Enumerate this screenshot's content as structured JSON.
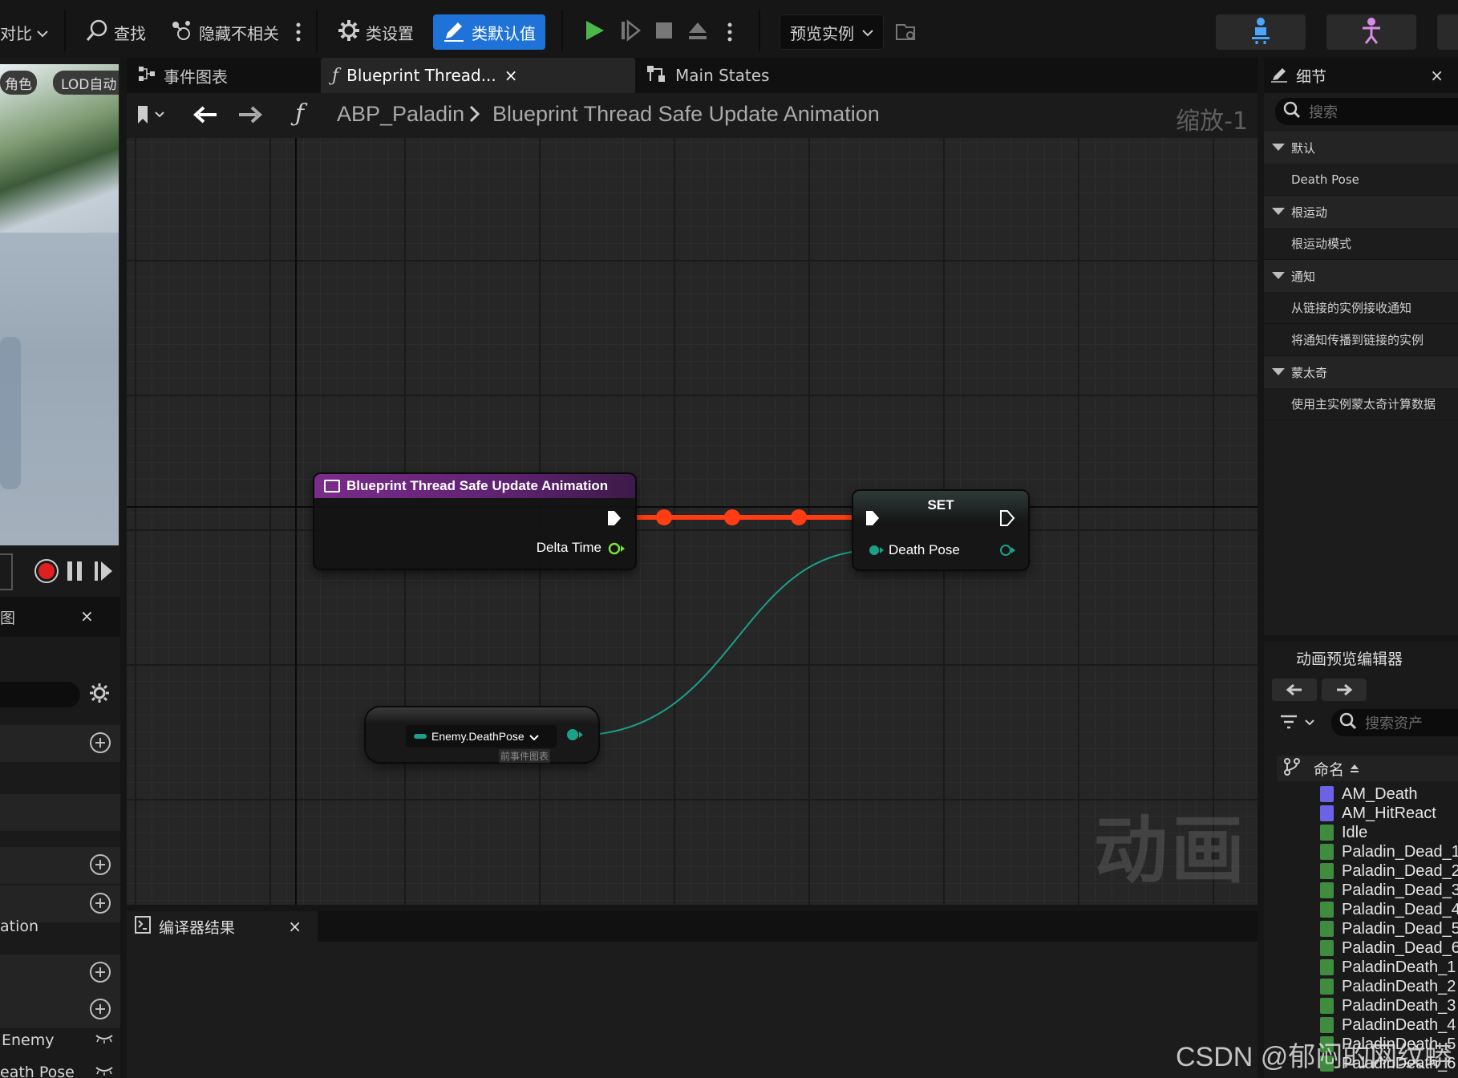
{
  "toolbar": {
    "compare_label": "对比",
    "find_label": "查找",
    "hide_unrelated_label": "隐藏不相关",
    "class_settings_label": "类设置",
    "class_defaults_label": "类默认值",
    "preview_instance_label": "预览实例"
  },
  "viewport": {
    "role_chip": "角色",
    "lod_chip": "LOD自动"
  },
  "tabs": {
    "event_graph": "事件图表",
    "blueprint_thread": "Blueprint Thread...",
    "main_states": "Main States"
  },
  "graph": {
    "breadcrumb_root": "ABP_Paladin",
    "breadcrumb_current": "Blueprint Thread Safe Update Animation",
    "zoom_label": "缩放-1",
    "watermark": "动画"
  },
  "nodes": {
    "entry": {
      "title": "Blueprint Thread Safe Update Animation",
      "pin_delta": "Delta Time"
    },
    "set": {
      "title": "SET",
      "pin_death_pose": "Death Pose"
    },
    "getter": {
      "label": "Enemy.DeathPose",
      "sublabel": "前事件图表"
    }
  },
  "left_panel": {
    "tab_partial": "图",
    "row_ation": "ation",
    "row_enemy": "Enemy",
    "row_death_pose": "eath Pose"
  },
  "details": {
    "title": "细节",
    "search_placeholder": "搜索",
    "categories": [
      {
        "label": "默认",
        "items": [
          "Death Pose"
        ]
      },
      {
        "label": "根运动",
        "items": [
          "根运动模式"
        ]
      },
      {
        "label": "通知",
        "items": [
          "从链接的实例接收通知",
          "将通知传播到链接的实例"
        ]
      },
      {
        "label": "蒙太奇",
        "items": [
          "使用主实例蒙太奇计算数据"
        ]
      }
    ]
  },
  "asset_browser": {
    "title": "动画预览编辑器",
    "search_placeholder": "搜索资产",
    "column_name": "命名",
    "items": [
      {
        "name": "AM_Death",
        "kind": "montage"
      },
      {
        "name": "AM_HitReact",
        "kind": "montage"
      },
      {
        "name": "Idle",
        "kind": "sequence"
      },
      {
        "name": "Paladin_Dead_1",
        "kind": "sequence"
      },
      {
        "name": "Paladin_Dead_2",
        "kind": "sequence"
      },
      {
        "name": "Paladin_Dead_3",
        "kind": "sequence"
      },
      {
        "name": "Paladin_Dead_4",
        "kind": "sequence"
      },
      {
        "name": "Paladin_Dead_5",
        "kind": "sequence"
      },
      {
        "name": "Paladin_Dead_6",
        "kind": "sequence"
      },
      {
        "name": "PaladinDeath_1",
        "kind": "sequence"
      },
      {
        "name": "PaladinDeath_2",
        "kind": "sequence"
      },
      {
        "name": "PaladinDeath_3",
        "kind": "sequence"
      },
      {
        "name": "PaladinDeath_4",
        "kind": "sequence"
      },
      {
        "name": "PaladinDeath_5",
        "kind": "sequence"
      },
      {
        "name": "PaladinDeath_6",
        "kind": "sequence"
      }
    ]
  },
  "compiler": {
    "tab_label": "编译器结果"
  },
  "overlay": {
    "csdn_watermark": "CSDN @郁闷的网纹蟒"
  },
  "colors": {
    "accent_blue": "#1f73d8",
    "exec_wire": "#ff3c14",
    "pose_pin": "#1ba089",
    "node_header_purple": "#7a2c8a",
    "play_green": "#4cb84c",
    "montage_icon": "#6b62e6",
    "sequence_icon": "#3f8c3f"
  }
}
